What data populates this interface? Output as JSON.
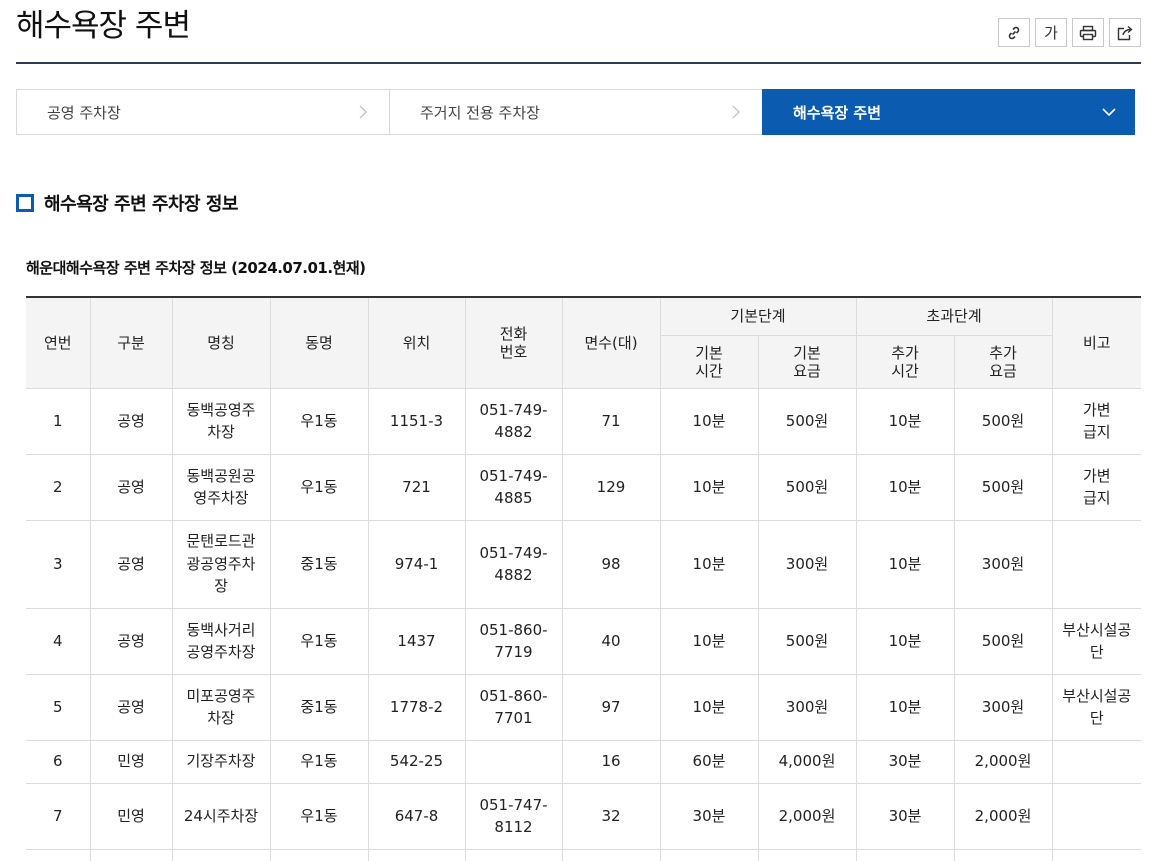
{
  "page": {
    "title": "해수욕장 주변"
  },
  "toolbar": {
    "font_label": "가"
  },
  "tabs": [
    {
      "label": "공영 주차장"
    },
    {
      "label": "주거지 전용 주차장"
    },
    {
      "label": "해수욕장 주변"
    }
  ],
  "section": {
    "title": "해수욕장 주변 주차장 정보"
  },
  "table": {
    "caption": "해운대해수욕장 주변 주차장 정보 (2024.07.01.현재)",
    "headers": {
      "no": "연번",
      "type": "구분",
      "name": "명칭",
      "dong": "동명",
      "location": "위치",
      "phone": "전화\n번호",
      "spaces": "면수(대)",
      "basic_group": "기본단계",
      "basic_time": "기본\n시간",
      "basic_fee": "기본\n요금",
      "extra_group": "초과단계",
      "extra_time": "추가\n시간",
      "extra_fee": "추가\n요금",
      "note": "비고"
    },
    "rows": [
      {
        "no": "1",
        "type": "공영",
        "name": "동백공영주\n차장",
        "dong": "우1동",
        "location": "1151-3",
        "phone": "051-749-\n4882",
        "spaces": "71",
        "basic_time": "10분",
        "basic_fee": "500원",
        "extra_time": "10분",
        "extra_fee": "500원",
        "note": "가변\n급지"
      },
      {
        "no": "2",
        "type": "공영",
        "name": "동백공원공\n영주차장",
        "dong": "우1동",
        "location": "721",
        "phone": "051-749-\n4885",
        "spaces": "129",
        "basic_time": "10분",
        "basic_fee": "500원",
        "extra_time": "10분",
        "extra_fee": "500원",
        "note": "가변\n급지"
      },
      {
        "no": "3",
        "type": "공영",
        "name": "문탠로드관\n광공영주차\n장",
        "dong": "중1동",
        "location": "974-1",
        "phone": "051-749-\n4882",
        "spaces": "98",
        "basic_time": "10분",
        "basic_fee": "300원",
        "extra_time": "10분",
        "extra_fee": "300원",
        "note": ""
      },
      {
        "no": "4",
        "type": "공영",
        "name": "동백사거리\n공영주차장",
        "dong": "우1동",
        "location": "1437",
        "phone": "051-860-\n7719",
        "spaces": "40",
        "basic_time": "10분",
        "basic_fee": "500원",
        "extra_time": "10분",
        "extra_fee": "500원",
        "note": "부산시설공\n단"
      },
      {
        "no": "5",
        "type": "공영",
        "name": "미포공영주\n차장",
        "dong": "중1동",
        "location": "1778-2",
        "phone": "051-860-\n7701",
        "spaces": "97",
        "basic_time": "10분",
        "basic_fee": "300원",
        "extra_time": "10분",
        "extra_fee": "300원",
        "note": "부산시설공\n단"
      },
      {
        "no": "6",
        "type": "민영",
        "name": "기장주차장",
        "dong": "우1동",
        "location": "542-25",
        "phone": "",
        "spaces": "16",
        "basic_time": "60분",
        "basic_fee": "4,000원",
        "extra_time": "30분",
        "extra_fee": "2,000원",
        "note": ""
      },
      {
        "no": "7",
        "type": "민영",
        "name": "24시주차장",
        "dong": "우1동",
        "location": "647-8",
        "phone": "051-747-\n8112",
        "spaces": "32",
        "basic_time": "30분",
        "basic_fee": "2,000원",
        "extra_time": "30분",
        "extra_fee": "2,000원",
        "note": ""
      }
    ]
  },
  "colors": {
    "accent": "#0b5bb0",
    "rule": "#2b3a55",
    "header_bg": "#f4f4f4"
  },
  "icons": [
    "link-icon",
    "font-size-icon",
    "print-icon",
    "share-icon",
    "chevron-right-icon",
    "chevron-down-icon",
    "square-bullet-icon"
  ]
}
